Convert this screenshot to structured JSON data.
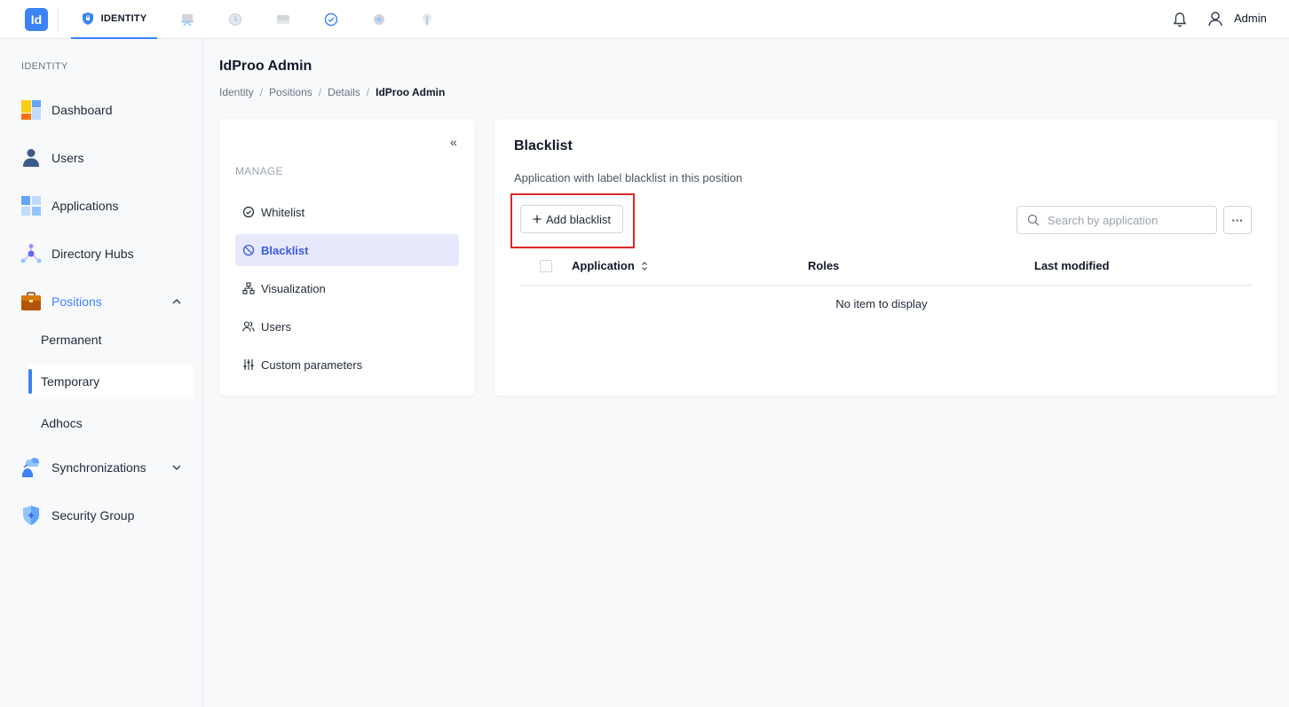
{
  "topbar": {
    "logo_text": "Id",
    "active_tab_label": "IDENTITY",
    "user_name": "Admin",
    "accent": "#3b82f6"
  },
  "sidebar": {
    "section_label": "IDENTITY",
    "items": [
      {
        "label": "Dashboard",
        "icon": "dashboard-icon"
      },
      {
        "label": "Users",
        "icon": "user-icon"
      },
      {
        "label": "Applications",
        "icon": "applications-icon"
      },
      {
        "label": "Directory Hubs",
        "icon": "directory-hub-icon"
      },
      {
        "label": "Positions",
        "icon": "briefcase-icon"
      },
      {
        "label": "Synchronizations",
        "icon": "cloud-sync-icon"
      },
      {
        "label": "Security Group",
        "icon": "shield-icon"
      }
    ],
    "position_subitems": [
      "Permanent",
      "Temporary",
      "Adhocs"
    ]
  },
  "header": {
    "title": "IdProo Admin",
    "breadcrumb": [
      "Identity",
      "Positions",
      "Details",
      "IdProo Admin"
    ]
  },
  "manage_menu": {
    "collapse_glyph": "«",
    "section_label": "MANAGE",
    "items": [
      "Whitelist",
      "Blacklist",
      "Visualization",
      "Users",
      "Custom parameters"
    ]
  },
  "blacklist": {
    "title": "Blacklist",
    "description": "Application with label blacklist in this position",
    "add_button_label": "Add blacklist",
    "search_placeholder": "Search by application",
    "more_label": "···",
    "columns": [
      "Application",
      "Roles",
      "Last modified"
    ],
    "empty_text": "No item to display"
  }
}
